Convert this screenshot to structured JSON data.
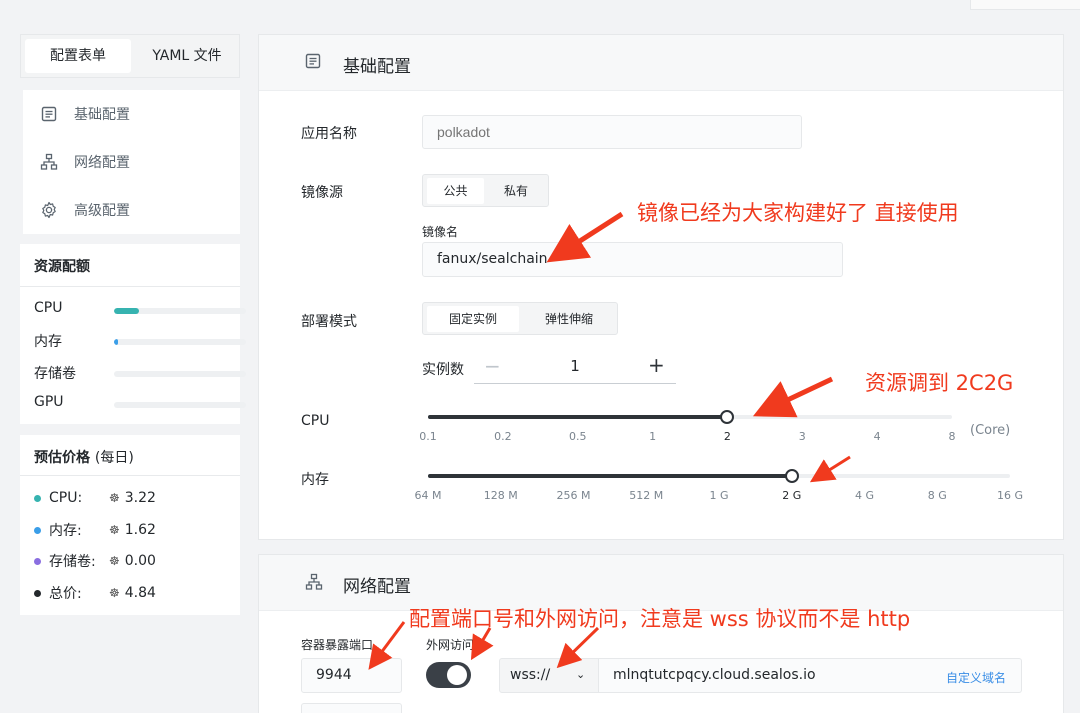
{
  "tabs": {
    "form": "配置表单",
    "yaml": "YAML 文件"
  },
  "nav": [
    {
      "label": "基础配置",
      "icon": "document-icon"
    },
    {
      "label": "网络配置",
      "icon": "network-icon"
    },
    {
      "label": "高级配置",
      "icon": "gear-icon"
    }
  ],
  "resources": {
    "title": "资源配额",
    "items": [
      {
        "label": "CPU",
        "level": 0.19,
        "color": "#36b3b0"
      },
      {
        "label": "内存",
        "level": 0.03,
        "color": "#3a9ee8"
      },
      {
        "label": "存储卷",
        "level": 0,
        "color": "#cccccc"
      },
      {
        "label": "GPU",
        "level": 0,
        "color": "#cccccc"
      }
    ]
  },
  "pricing": {
    "title": "预估价格",
    "title_suffix": "(每日)",
    "items": [
      {
        "label": "CPU:",
        "value": "3.22",
        "color": "#36b3b0"
      },
      {
        "label": "内存:",
        "value": "1.62",
        "color": "#3a9ee8"
      },
      {
        "label": "存储卷:",
        "value": "0.00",
        "color": "#8a6ee0"
      },
      {
        "label": "总价:",
        "value": "4.84",
        "color": "#24282c"
      }
    ]
  },
  "basic": {
    "title": "基础配置",
    "app_name_label": "应用名称",
    "app_name_placeholder": "polkadot",
    "image_source_label": "镜像源",
    "image_source_options": [
      "公共",
      "私有"
    ],
    "image_name_label": "镜像名",
    "image_name_value": "fanux/sealchain",
    "deploy_mode_label": "部署模式",
    "deploy_mode_options": [
      "固定实例",
      "弹性伸缩"
    ],
    "instances_label": "实例数",
    "instances_value": "1",
    "cpu_label": "CPU",
    "cpu_ticks": [
      "0.1",
      "0.2",
      "0.5",
      "1",
      "2",
      "3",
      "4",
      "8"
    ],
    "cpu_unit": "(Core)",
    "cpu_selected_index": 4,
    "mem_label": "内存",
    "mem_ticks": [
      "64 M",
      "128 M",
      "256 M",
      "512 M",
      "1 G",
      "2 G",
      "4 G",
      "8 G",
      "16 G"
    ],
    "mem_selected_index": 5
  },
  "network": {
    "title": "网络配置",
    "port_label": "容器暴露端口",
    "port_value": "9944",
    "public_label": "外网访问",
    "public_enabled": true,
    "protocol": "wss://",
    "domain": "mlnqtutcpqcy.cloud.sealos.io",
    "custom_domain": "自定义域名"
  },
  "annotations": {
    "image": "镜像已经为大家构建好了 直接使用",
    "resource": "资源调到 2C2G",
    "network": "配置端口号和外网访问，注意是 wss 协议而不是 http"
  },
  "colors": {
    "annotation": "#f03a1e",
    "slider": "#2e3338"
  }
}
